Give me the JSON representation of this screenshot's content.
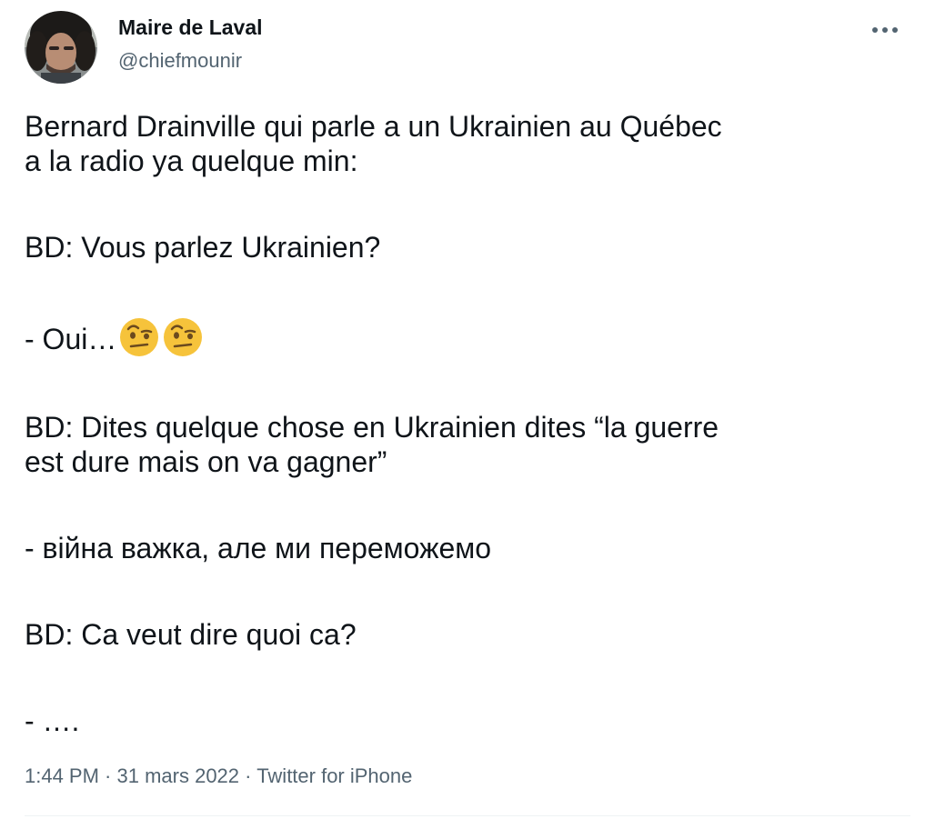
{
  "author": {
    "name": "Maire de Laval",
    "handle": "@chiefmounir"
  },
  "tweet": {
    "line_1": "Bernard Drainville qui parle a un Ukrainien au Québec",
    "line_2": "a la radio ya quelque min:",
    "line_3": "BD: Vous parlez Ukrainien?",
    "line_4": "- Oui…",
    "line_5": "BD: Dites quelque chose en Ukrainien dites “la guerre",
    "line_6": "est dure mais on va gagner”",
    "line_7": "-  війна важка, але ми переможемо",
    "line_8": "BD: Ca veut dire quoi ca?",
    "line_9": "- ….",
    "emojis": [
      "face-with-raised-eyebrow-emoji",
      "face-with-raised-eyebrow-emoji"
    ]
  },
  "meta": {
    "time": "1:44 PM",
    "separator": " · ",
    "date": "31 mars 2022",
    "source": "Twitter for iPhone"
  },
  "icons": {
    "more": "more-horizontal-icon"
  },
  "colors": {
    "text_primary": "#0f1419",
    "text_secondary": "#536471",
    "emoji_yellow": "#f6c33b",
    "divider": "#eff3f4"
  }
}
